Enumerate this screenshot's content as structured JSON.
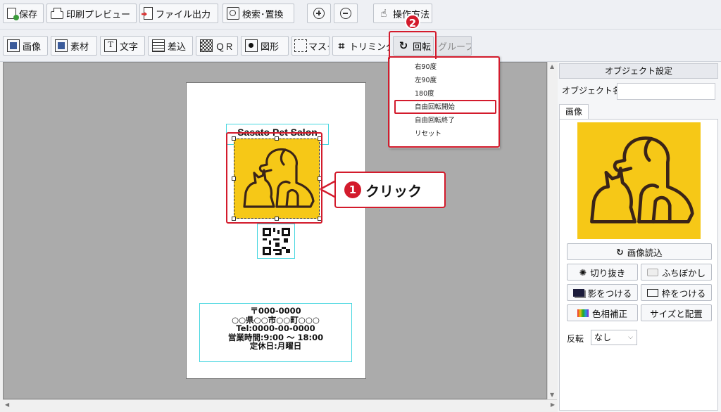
{
  "toolbar_main": {
    "save": "保存",
    "print_preview": "印刷プレビュー",
    "file_export": "ファイル出力",
    "search_replace": "検索･置換",
    "help": "操作方法"
  },
  "toolbar_insert": {
    "image": "画像",
    "material": "素材",
    "text": "文字",
    "merge": "差込",
    "qr": "ＱＲ",
    "shape": "図形",
    "mask": "マスク",
    "trim": "トリミング",
    "rotate": "回転",
    "group": "グループ"
  },
  "rotate_menu": {
    "items": [
      "右90度",
      "左90度",
      "180度",
      "自由回転開始",
      "自由回転終了",
      "リセット"
    ],
    "highlighted": "自由回転開始"
  },
  "card": {
    "shop_name": "Sasato Pet Salon",
    "address_lines": [
      "〒000-0000",
      "○○県○○市○○町○○○",
      "Tel:0000-00-0000",
      "営業時間:9:00 ～ 18:00",
      "定休日:月曜日"
    ]
  },
  "annotations": {
    "step1_num": "1",
    "step1_label": "クリック",
    "step2_num": "2"
  },
  "panel": {
    "title": "オブジェクト設定",
    "object_name_label": "オブジェクト名",
    "object_name_value": "",
    "tab_image": "画像",
    "load_image": "画像読込",
    "crop": "切り抜き",
    "blur": "ふちぼかし",
    "shadow": "影をつける",
    "frame": "枠をつける",
    "color_correct": "色相補正",
    "size_position": "サイズと配置",
    "flip_label": "反転",
    "flip_value": "なし"
  },
  "colors": {
    "accent_red": "#d31b2c",
    "image_yellow": "#f6c817",
    "selection_cyan": "#45d6e0"
  }
}
